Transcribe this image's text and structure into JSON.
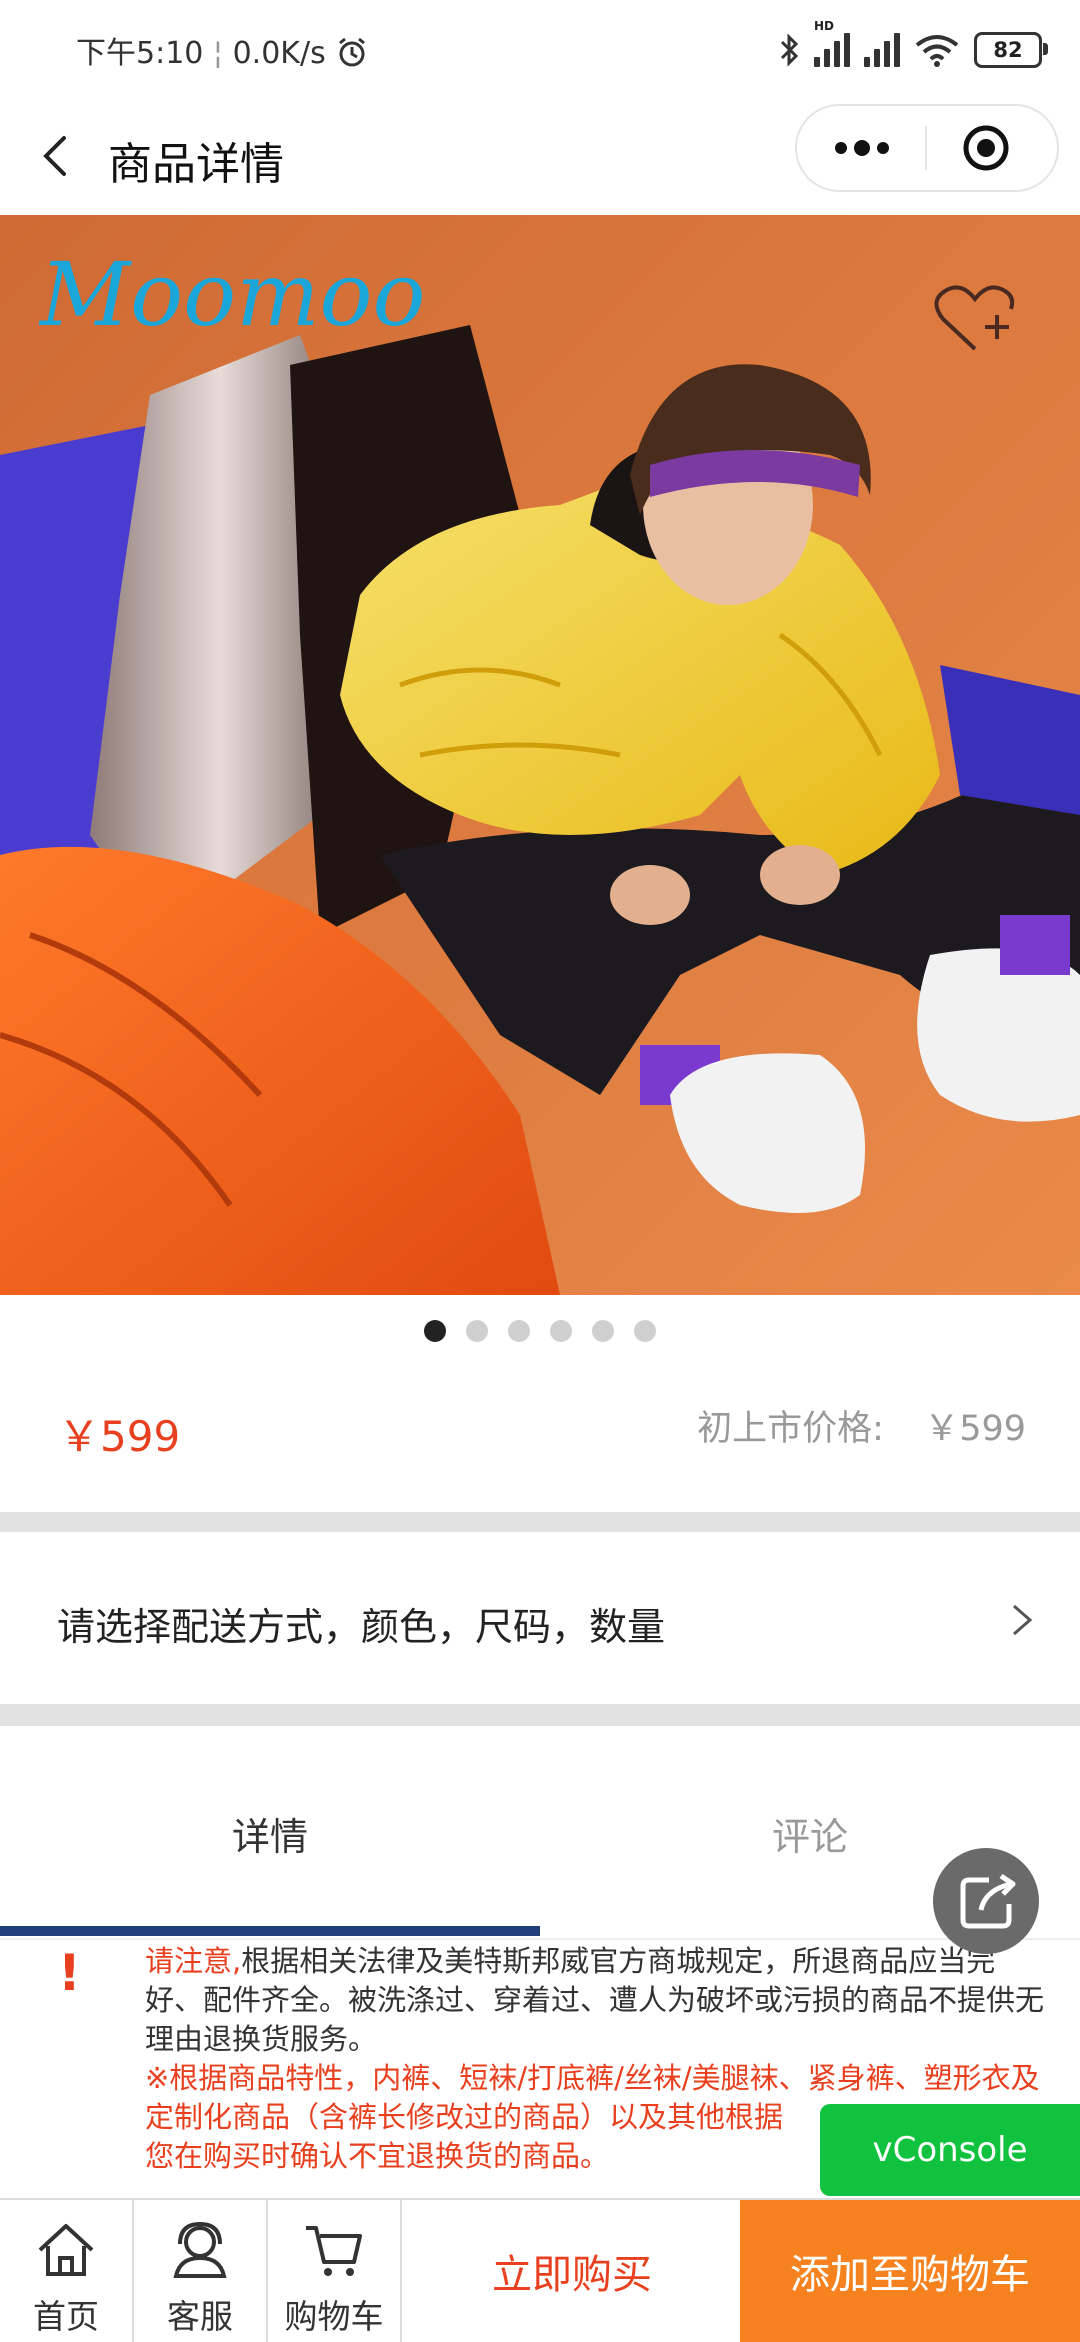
{
  "status_bar": {
    "time": "下午5:10",
    "network_speed": "0.0K/s",
    "battery": "82",
    "signal_label": "HD"
  },
  "nav": {
    "title": "商品详情"
  },
  "hero": {
    "brand_logo_text": "Moomoo",
    "slide_count": 6,
    "active_slide": 1
  },
  "product": {
    "price": "￥599",
    "original_price_label": "初上市价格:",
    "original_price": "￥599"
  },
  "spec": {
    "prompt": "请选择配送方式，颜色，尺码，数量"
  },
  "tabs": [
    {
      "label": "详情",
      "active": true
    },
    {
      "label": "评论",
      "active": false
    }
  ],
  "notice": {
    "highlight": "请注意,",
    "body": "根据相关法律及美特斯邦威官方商城规定，所退商品应当完好、配件齐全。被洗涤过、穿着过、遭人为破坏或污损的商品不提供无理由退换货服务。",
    "red_note": "※根据商品特性，内裤、短袜/打底裤/丝袜/美腿袜、紧身裤、塑形衣及定制化商品（含裤长修改过的商品）以及其他根据",
    "red_note_end": "您在购买时确认不宜退换货的商品。"
  },
  "vconsole_label": "vConsole",
  "bottom_bar": {
    "home": "首页",
    "service": "客服",
    "cart": "购物车",
    "buy_now": "立即购买",
    "add_to_cart": "添加至购物车"
  },
  "colors": {
    "accent_red": "#e8401f",
    "cart_orange": "#f5821f",
    "tab_underline": "#1f3e7a",
    "vconsole_green": "#10c23e"
  }
}
